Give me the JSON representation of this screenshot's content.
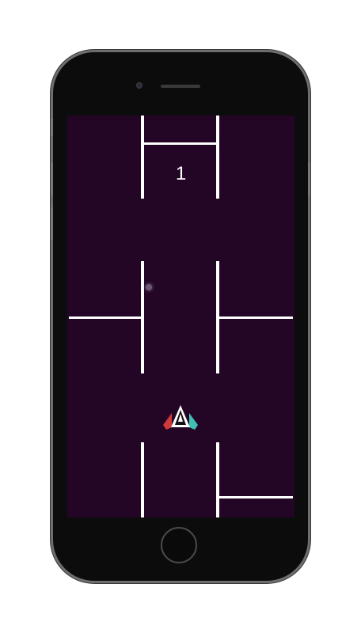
{
  "game": {
    "score": "1",
    "colors": {
      "background": "#230626",
      "walls": "#ffffff",
      "ship_left": "#d0393b",
      "ship_right": "#3fbfb3",
      "ship_body": "#ffffff",
      "orb": "#6d5a72"
    },
    "icons": {
      "player": "spaceship-icon",
      "collectible": "orb-icon"
    }
  }
}
